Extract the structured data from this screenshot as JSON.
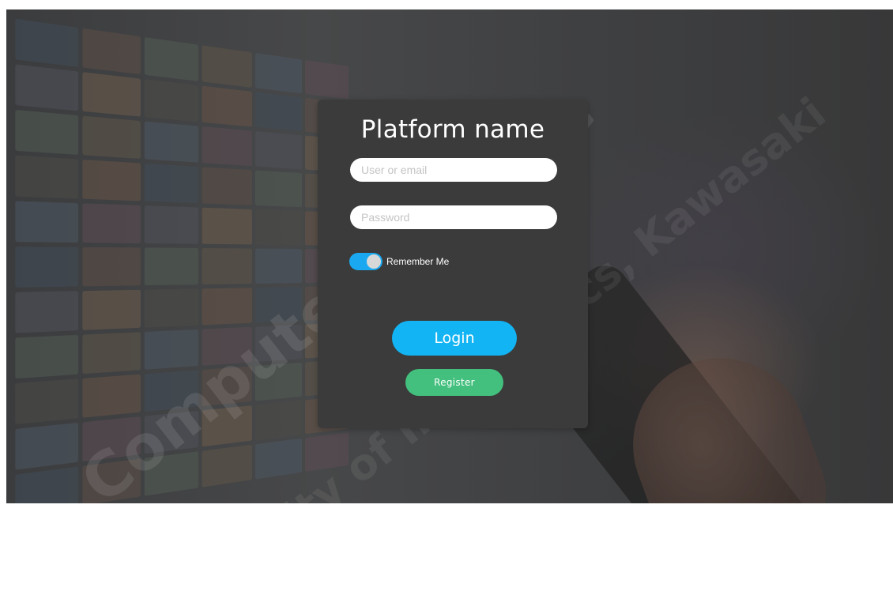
{
  "login": {
    "platform_name": "Platform name",
    "user_placeholder": "User or email",
    "user_value": "",
    "password_placeholder": "Password",
    "password_value": "",
    "remember_label": "Remember Me",
    "remember_checked": true,
    "login_label": "Login",
    "register_label": "Register"
  },
  "colors": {
    "card_bg": "#3b3b3b",
    "toggle_on": "#1aa9f0",
    "login_button": "#12b4f3",
    "register_button": "#43c07e",
    "background_overlay": "#404142"
  },
  "watermark": {
    "line1": "Computer Science",
    "line2": "Faculty of Informatics, Kawasaki"
  }
}
